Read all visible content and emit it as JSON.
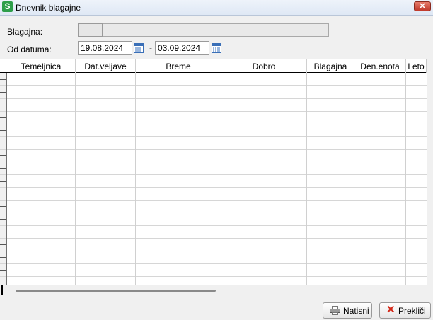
{
  "window": {
    "title": "Dnevnik blagajne",
    "icon_letter": "S",
    "close_glyph": "✕"
  },
  "form": {
    "cash_label": "Blagajna:",
    "date_label": "Od datuma:",
    "date_from": "19.08.2024",
    "date_sep": "-",
    "date_to": "03.09.2024"
  },
  "grid": {
    "columns": [
      "Temeljnica",
      "Dat.veljave",
      "Breme",
      "Dobro",
      "Blagajna",
      "Den.enota",
      "Leto"
    ],
    "rows": []
  },
  "buttons": {
    "print_label": "Natisni",
    "cancel_label": "Prekliči"
  },
  "icons": {
    "app": "app-s-icon",
    "calendar": "calendar-icon",
    "print": "printer-icon",
    "cancel": "x-icon"
  },
  "colors": {
    "app_icon": "#2e9e4a",
    "close_button": "#c0392b",
    "cancel_icon": "#d42a1a"
  }
}
